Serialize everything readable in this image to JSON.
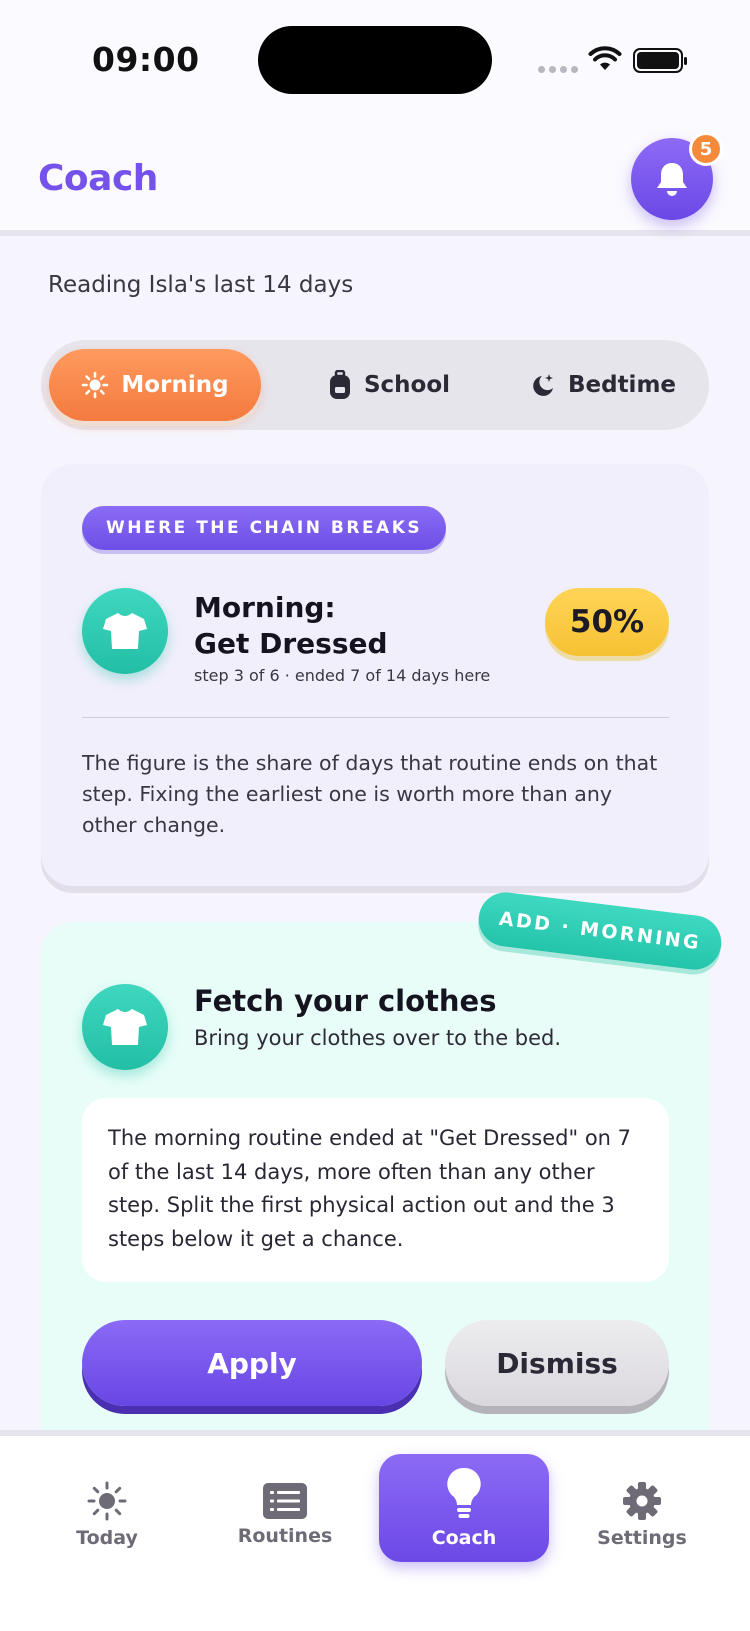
{
  "status_bar": {
    "time": "09:00"
  },
  "header": {
    "title": "Coach",
    "notification_count": "5"
  },
  "subtitle": "Reading Isla's last 14 days",
  "segments": [
    {
      "label": "Morning",
      "icon": "sun-icon",
      "selected": true
    },
    {
      "label": "School",
      "icon": "backpack-icon",
      "selected": false
    },
    {
      "label": "Bedtime",
      "icon": "moon-icon",
      "selected": false
    }
  ],
  "chain_card": {
    "label": "WHERE THE CHAIN BREAKS",
    "step_title_line1": "Morning:",
    "step_title_line2": "Get Dressed",
    "step_meta": "step 3 of 6 · ended 7 of 14 days here",
    "percent": "50%",
    "explanation": "The figure is the share of days that routine ends on that step. Fixing the earliest one is worth more than any other change."
  },
  "suggestion": {
    "tag": "ADD · MORNING",
    "title": "Fetch your clothes",
    "description": "Bring your clothes over to the bed.",
    "reason": "The morning routine ended at \"Get Dressed\" on 7 of the last 14 days, more often than any other step. Split the first physical action out and the 3 steps below it get a chance.",
    "apply_label": "Apply",
    "dismiss_label": "Dismiss"
  },
  "tabs": [
    {
      "label": "Today",
      "icon": "sun-icon"
    },
    {
      "label": "Routines",
      "icon": "list-icon"
    },
    {
      "label": "Coach",
      "icon": "lightbulb-icon",
      "active": true
    },
    {
      "label": "Settings",
      "icon": "gear-icon"
    }
  ],
  "colors": {
    "accent": "#7552EC",
    "morning": "#F47A3E",
    "teal": "#22BFA5",
    "yellow": "#F6C233"
  }
}
